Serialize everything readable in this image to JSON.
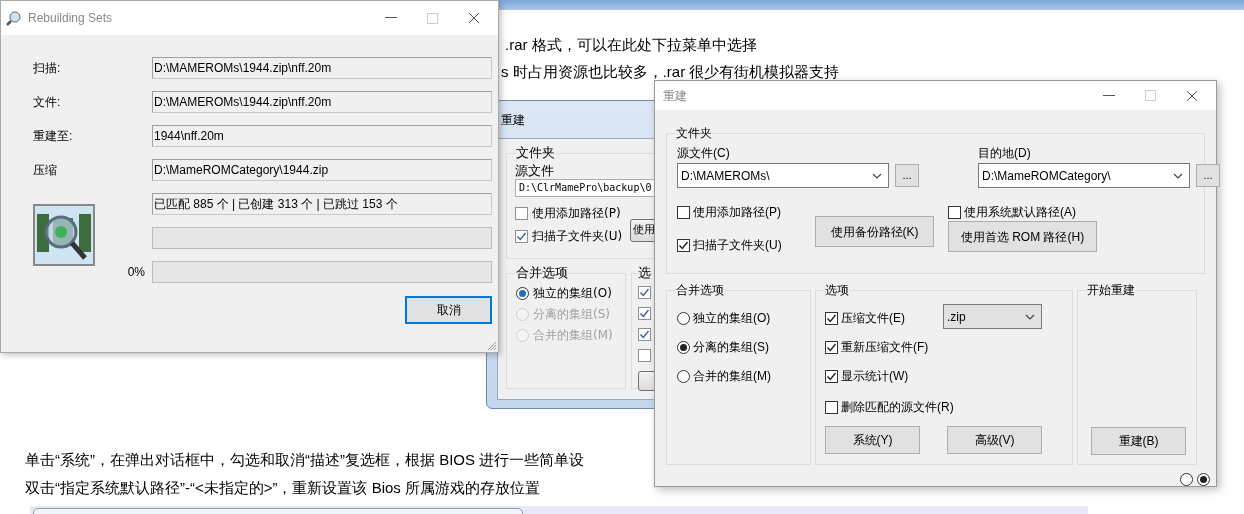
{
  "article": {
    "top_lines": [
      ".rar 格式，可以在此处下拉菜单中选择",
      "s 时占用资源也比较多，.rar 很少有街机模拟器支持"
    ],
    "bottom_lines": [
      "单击“系统”，在弹出对话框中，勾选和取消“描述”复选框，根据 BIOS 进行一些简单设",
      "双击“指定系统默认路径”-“<未指定的>”，重新设置该 Bios 所属游戏的存放位置"
    ]
  },
  "progress_window": {
    "title": "Rebuilding Sets",
    "rows": [
      {
        "label": "扫描:",
        "value": "D:\\MAMEROMs\\1944.zip\\nff.20m"
      },
      {
        "label": "文件:",
        "value": "D:\\MAMEROMs\\1944.zip\\nff.20m"
      },
      {
        "label": "重建至:",
        "value": "1944\\nff.20m"
      },
      {
        "label": "压缩",
        "value": "D:\\MameROMCategory\\1944.zip"
      }
    ],
    "stats": "已匹配 885 个 | 已创建 313 个 | 已跳过 153 个",
    "progress": [
      {
        "level": 0
      },
      {
        "level": 0,
        "reading": "0%"
      }
    ],
    "cancel_button": "取消"
  },
  "back_window": {
    "title": "重建",
    "folder_group": {
      "title": "文件夹",
      "source_label": "源文件",
      "source_value": "D:\\ClrMamePro\\backup\\0",
      "checkboxes": [
        {
          "label": "使用添加路径(P)",
          "checked": false
        },
        {
          "label": "扫描子文件夹(U)",
          "checked": true
        }
      ],
      "button": "使用"
    },
    "merge_group": {
      "title": "合并选项",
      "radios": [
        {
          "label": "独立的集组(O)",
          "selected": true,
          "disabled": false
        },
        {
          "label": "分离的集组(S)",
          "selected": false,
          "disabled": true
        },
        {
          "label": "合并的集组(M)",
          "selected": false,
          "disabled": true
        }
      ]
    },
    "options_group": {
      "title": "选",
      "checkboxes": [
        {
          "checked": true
        },
        {
          "checked": true
        },
        {
          "checked": true
        },
        {
          "checked": false
        }
      ]
    }
  },
  "rebuild_window": {
    "title": "重建",
    "folder_group": {
      "title": "文件夹",
      "source": {
        "label": "源文件(C)",
        "value": "D:\\MAMEROMs\\",
        "browse": "..."
      },
      "destination": {
        "label": "目的地(D)",
        "value": "D:\\MameROMCategory\\",
        "browse": "..."
      },
      "use_add_path": {
        "label": "使用添加路径(P)",
        "checked": false
      },
      "scan_subfolders": {
        "label": "扫描子文件夹(U)",
        "checked": true
      },
      "use_system_default": {
        "label": "使用系统默认路径(A)",
        "checked": false
      },
      "backup_button": "使用备份路径(K)",
      "preferred_button": "使用首选 ROM 路径(H)"
    },
    "merge_group": {
      "title": "合并选项",
      "radios": [
        {
          "label": "独立的集组(O)",
          "selected": false
        },
        {
          "label": "分离的集组(S)",
          "selected": true
        },
        {
          "label": "合并的集组(M)",
          "selected": false
        }
      ]
    },
    "options_group": {
      "title": "选项",
      "checkboxes": [
        {
          "label": "压缩文件(E)",
          "checked": true
        },
        {
          "label": "重新压缩文件(F)",
          "checked": true
        },
        {
          "label": "显示统计(W)",
          "checked": true
        },
        {
          "label": "删除匹配的源文件(R)",
          "checked": false
        }
      ],
      "format": ".zip",
      "buttons": [
        "系统(Y)",
        "高级(V)"
      ]
    },
    "start_group": {
      "title": "开始重建",
      "button": "重建(B)"
    },
    "page_dots": [
      {
        "selected": false
      },
      {
        "selected": true
      }
    ]
  }
}
